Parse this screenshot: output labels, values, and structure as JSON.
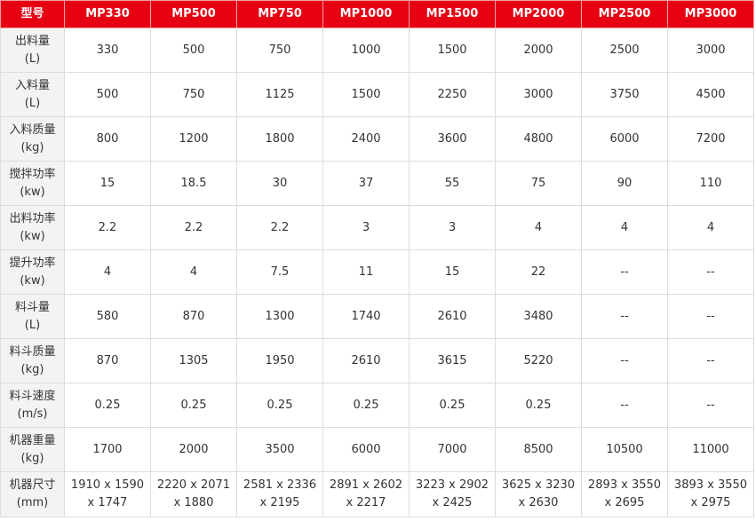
{
  "header": {
    "label": "型号",
    "models": [
      "MP330",
      "MP500",
      "MP750",
      "MP1000",
      "MP1500",
      "MP2000",
      "MP2500",
      "MP3000"
    ]
  },
  "rows": [
    {
      "name": "出料量",
      "unit": "(L)",
      "values": [
        "330",
        "500",
        "750",
        "1000",
        "1500",
        "2000",
        "2500",
        "3000"
      ]
    },
    {
      "name": "入料量",
      "unit": "(L)",
      "values": [
        "500",
        "750",
        "1125",
        "1500",
        "2250",
        "3000",
        "3750",
        "4500"
      ]
    },
    {
      "name": "入料质量",
      "unit": "(kg)",
      "values": [
        "800",
        "1200",
        "1800",
        "2400",
        "3600",
        "4800",
        "6000",
        "7200"
      ]
    },
    {
      "name": "搅拌功率",
      "unit": "(kw)",
      "values": [
        "15",
        "18.5",
        "30",
        "37",
        "55",
        "75",
        "90",
        "110"
      ]
    },
    {
      "name": "出料功率",
      "unit": "(kw)",
      "values": [
        "2.2",
        "2.2",
        "2.2",
        "3",
        "3",
        "4",
        "4",
        "4"
      ]
    },
    {
      "name": "提升功率",
      "unit": "(kw)",
      "values": [
        "4",
        "4",
        "7.5",
        "11",
        "15",
        "22",
        "--",
        "--"
      ]
    },
    {
      "name": "料斗量",
      "unit": "(L)",
      "values": [
        "580",
        "870",
        "1300",
        "1740",
        "2610",
        "3480",
        "--",
        "--"
      ]
    },
    {
      "name": "料斗质量",
      "unit": "(kg)",
      "values": [
        "870",
        "1305",
        "1950",
        "2610",
        "3615",
        "5220",
        "--",
        "--"
      ]
    },
    {
      "name": "料斗速度",
      "unit": "(m/s)",
      "values": [
        "0.25",
        "0.25",
        "0.25",
        "0.25",
        "0.25",
        "0.25",
        "--",
        "--"
      ]
    },
    {
      "name": "机器重量",
      "unit": "(kg)",
      "values": [
        "1700",
        "2000",
        "3500",
        "6000",
        "7000",
        "8500",
        "10500",
        "11000"
      ]
    },
    {
      "name": "机器尺寸",
      "unit": "(mm)",
      "values": [
        [
          "1910 x 1590",
          "x 1747"
        ],
        [
          "2220 x 2071",
          "x 1880"
        ],
        [
          "2581 x 2336",
          "x 2195"
        ],
        [
          "2891 x 2602",
          "x 2217"
        ],
        [
          "3223 x 2902",
          "x 2425"
        ],
        [
          "3625 x 3230",
          "x 2630"
        ],
        [
          "2893 x 3550",
          "x 2695"
        ],
        [
          "3893 x 3550",
          "x 2975"
        ]
      ]
    }
  ],
  "colors": {
    "header_bg": "#e60012",
    "header_text": "#ffffff",
    "row_head_bg": "#f3f3f3",
    "border": "#dcdcdc",
    "text": "#333333"
  }
}
